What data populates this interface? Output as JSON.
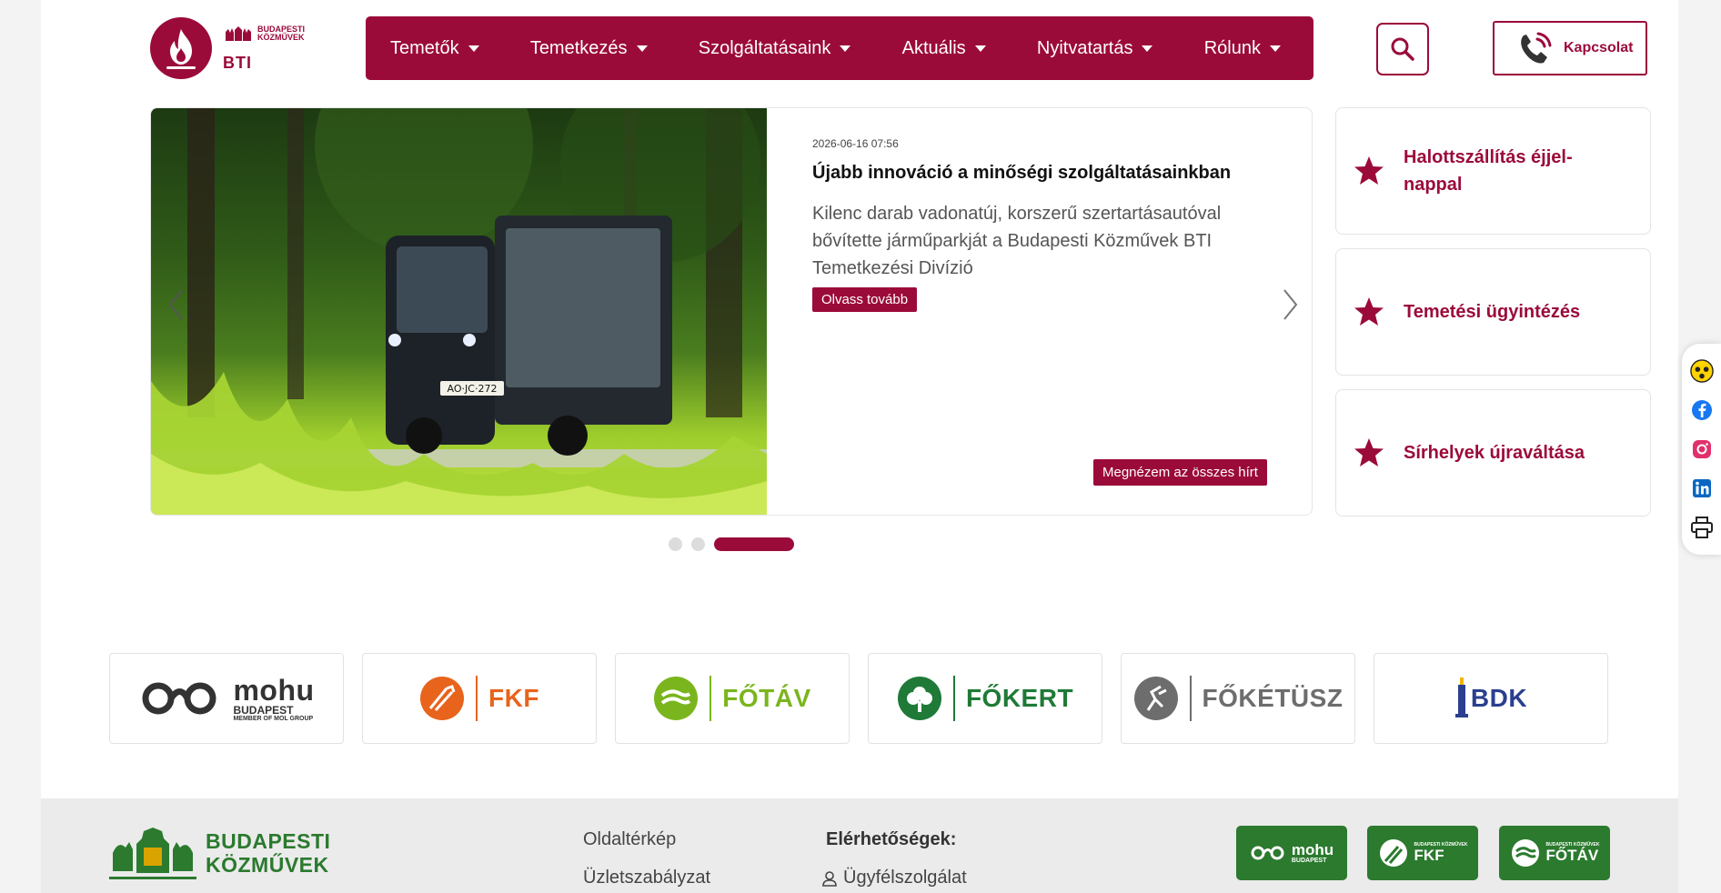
{
  "brand": {
    "name": "BTI",
    "crest_line1": "BUDAPESTI",
    "crest_line2": "KÖZMŰVEK",
    "accent_color": "#9b0b3a"
  },
  "nav": {
    "items": [
      {
        "label": "Temetők"
      },
      {
        "label": "Temetkezés"
      },
      {
        "label": "Szolgáltatásaink"
      },
      {
        "label": "Aktuális"
      },
      {
        "label": "Nyitvatartás"
      },
      {
        "label": "Rólunk"
      }
    ]
  },
  "header": {
    "search_icon": "search-icon",
    "contact_label": "Kapcsolat",
    "contact_icon": "phone-icon"
  },
  "slider": {
    "date": "2026-06-16 07:56",
    "title": "Újabb innováció a minőségi szolgáltatásainkban",
    "text": "Kilenc darab vadonatúj, korszerű szertartásautóval bővítette járműparkját a Budapesti Közművek BTI Temetkezési Divízió",
    "read_more": "Olvass tovább",
    "all_news": "Megnézem az összes hírt",
    "image_plate": "AO·JC·272",
    "dots_count": 3,
    "active_dot": 3
  },
  "quick_links": [
    {
      "label": "Halottszállítás éjjel-nappal"
    },
    {
      "label": "Temetési ügyintézés"
    },
    {
      "label": "Sírhelyek újraváltása"
    }
  ],
  "partners": [
    {
      "name": "mohu",
      "sub": "BUDAPEST",
      "sub2": "MEMBER OF MOL GROUP",
      "color": "#333333"
    },
    {
      "name": "FKF",
      "color": "#e8631c"
    },
    {
      "name": "FŐTÁV",
      "color": "#7ab51d"
    },
    {
      "name": "FŐKERT",
      "color": "#1e7a36"
    },
    {
      "name": "FŐKÉTÜSZ",
      "color": "#6d6d6d"
    },
    {
      "name": "BDK",
      "color": "#2a3f8f"
    }
  ],
  "footer": {
    "logo_line1": "BUDAPESTI",
    "logo_line2": "KÖZMŰVEK",
    "links": [
      "Oldaltérkép",
      "Üzletszabályzat"
    ],
    "contact_heading": "Elérhetőségek:",
    "customer_service": "Ügyfélszolgálat",
    "badges": [
      {
        "name": "mohu",
        "sub": "BUDAPEST"
      },
      {
        "name": "FKF",
        "sub": "BUDAPESTI KÖZMŰVEK"
      },
      {
        "name": "FŐTÁV",
        "sub": "BUDAPESTI KÖZMŰVEK"
      }
    ]
  },
  "sidebar": {
    "icons": [
      "accessibility-icon",
      "facebook-icon",
      "instagram-icon",
      "linkedin-icon",
      "print-icon"
    ]
  }
}
